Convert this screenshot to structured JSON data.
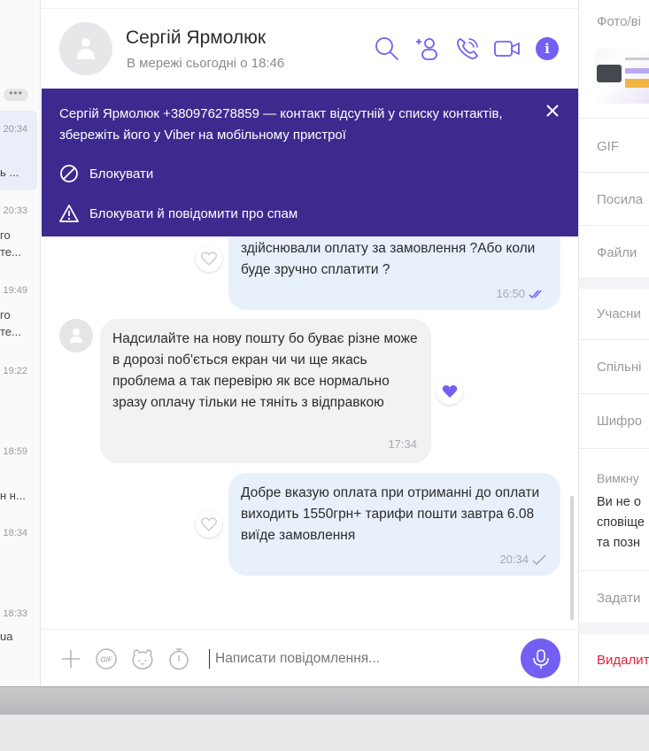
{
  "chat_list": {
    "items": [
      {
        "time": "20:34",
        "snippet": "ь ..."
      },
      {
        "time": "20:33",
        "snippet": "го\nте..."
      },
      {
        "time": "19:49",
        "snippet": "го\nте..."
      },
      {
        "time": "19:22",
        "snippet": ""
      },
      {
        "time": "18:59",
        "snippet": "н н..."
      },
      {
        "time": "18:34",
        "snippet": ""
      },
      {
        "time": "18:33",
        "snippet": "ua"
      }
    ],
    "more_label": "•••"
  },
  "header": {
    "name": "Сергій Ярмолюк",
    "status": "В мережі сьогодні о 18:46",
    "icons": [
      "search-icon",
      "add-contact-icon",
      "call-icon",
      "video-call-icon",
      "info-icon"
    ]
  },
  "banner": {
    "text": "Сергій Ярмолюк +380976278859 — контакт відсутній у списку контактів, збережіть його у Viber на мобільному пристрої",
    "block_label": "Блокувати",
    "block_report_label": "Блокувати й повідомити про спам"
  },
  "messages": [
    {
      "direction": "out",
      "text": "здійснювали оплату за замовлення ?Або коли буде зручно сплатити ?",
      "time": "16:50",
      "status": "read"
    },
    {
      "direction": "in",
      "text": "Надсилайте на нову пошту бо буває різне може в дорозі поб'ється екран чи чи ще якась проблема а так перевірю як все нормально зразу оплачу тільки не тяніть з відправкою",
      "time": "17:34",
      "liked": true
    },
    {
      "direction": "out",
      "text": "Добре вказую оплата при отриманні до оплати виходить  1550грн+ тарифи пошти завтра 6.08 виїде замовлення",
      "time": "20:34",
      "status": "delivered"
    }
  ],
  "composer": {
    "placeholder": "Написати повідомлення...",
    "icons": [
      "plus-icon",
      "gif-icon",
      "sticker-icon",
      "timer-icon",
      "mic-icon"
    ]
  },
  "right_panel": {
    "media_label": "Фото/ві",
    "gif_label": "GIF",
    "links_label": "Посила",
    "files_label": "Файли",
    "members_label": "Учасни",
    "common_label": "Спільні",
    "encryption_label": "Шифро",
    "mute_label": "Вимкну",
    "mute_text": [
      "Ви не о",
      "сповіще",
      "та позн"
    ],
    "set_label": "Задати",
    "delete_label": "Видалит"
  },
  "colors": {
    "accent": "#7360f2",
    "banner": "#3e2a8e",
    "outgoing_bubble": "#e8f0fc",
    "incoming_bubble": "#f2f2f2",
    "danger": "#e0203a"
  }
}
